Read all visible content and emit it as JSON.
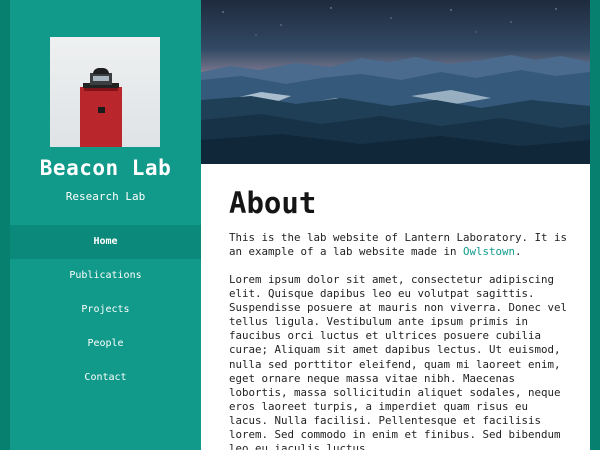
{
  "sidebar": {
    "brand": "Beacon Lab",
    "tagline": "Research Lab",
    "nav": [
      {
        "label": "Home",
        "active": true
      },
      {
        "label": "Publications",
        "active": false
      },
      {
        "label": "Projects",
        "active": false
      },
      {
        "label": "People",
        "active": false
      },
      {
        "label": "Contact",
        "active": false
      }
    ]
  },
  "main": {
    "title": "About",
    "intro_before": "This is the lab website of Lantern Laboratory. It is an example of a lab website made in ",
    "intro_link": "Owlstown",
    "intro_after": ".",
    "body": "Lorem ipsum dolor sit amet, consectetur adipiscing elit. Quisque dapibus leo eu volutpat sagittis. Suspendisse posuere at mauris non viverra. Donec vel tellus ligula. Vestibulum ante ipsum primis in faucibus orci luctus et ultrices posuere cubilia curae; Aliquam sit amet dapibus lectus. Ut euismod, nulla sed porttitor eleifend, quam mi laoreet enim, eget ornare neque massa vitae nibh. Maecenas lobortis, massa sollicitudin aliquet sodales, neque eros laoreet turpis, a imperdiet quam risus eu lacus. Nulla facilisi. Pellentesque et facilisis lorem. Sed commodo in enim et finibus. Sed bibendum leo eu iaculis luctus."
  },
  "colors": {
    "frame": "#08806f",
    "sidebar": "#11998a",
    "nav_active": "#0b8a7b",
    "link": "#129b8c"
  },
  "icons": [
    "lighthouse-logo",
    "mountain-hero-image"
  ]
}
